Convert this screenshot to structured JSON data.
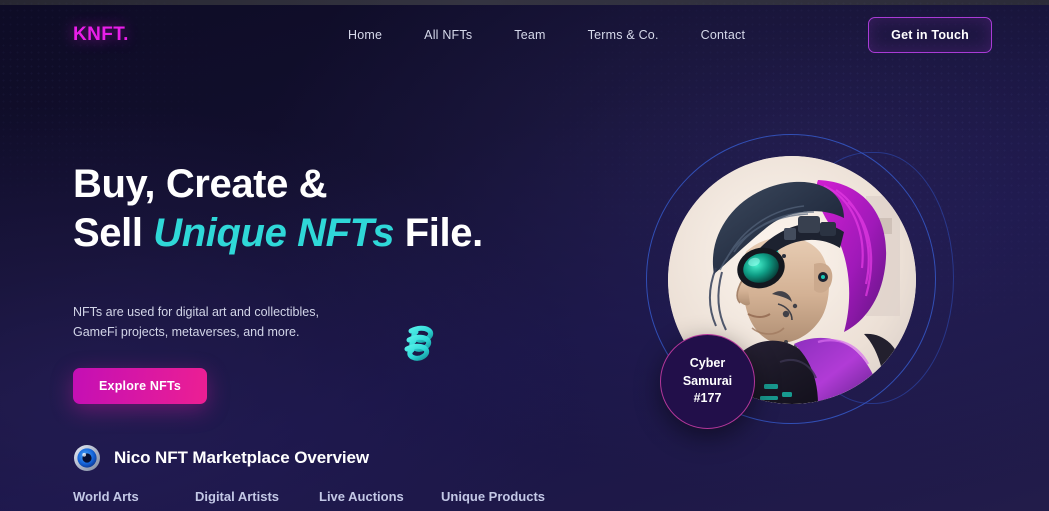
{
  "brand": {
    "logo": "KNFT."
  },
  "nav": {
    "items": [
      {
        "label": "Home"
      },
      {
        "label": "All NFTs"
      },
      {
        "label": "Team"
      },
      {
        "label": "Terms & Co."
      },
      {
        "label": "Contact"
      }
    ],
    "cta_label": "Get in Touch"
  },
  "hero": {
    "headline_line1": "Buy, Create &",
    "headline_line2_pre": "Sell ",
    "headline_line2_accent": "Unique NFTs",
    "headline_line2_post": " File.",
    "paragraph": "NFTs are used for digital art and collectibles, GameFi projects, metaverses, and more.",
    "explore_label": "Explore NFTs",
    "badge_line1": "Cyber",
    "badge_line2": "Samurai",
    "badge_line3": "#177"
  },
  "overview": {
    "title": "Nico NFT Marketplace Overview",
    "features": [
      {
        "label": "World Arts"
      },
      {
        "label": "Digital Artists"
      },
      {
        "label": "Live Auctions"
      },
      {
        "label": "Unique Products"
      }
    ]
  },
  "colors": {
    "background": "#120f2e",
    "background_bottom": "#221c4a",
    "brand_magenta": "#e91ee9",
    "accent_cyan": "#2fd8d8",
    "button_gradient_start": "#c40fb5",
    "button_gradient_end": "#ec1f93",
    "outline_border": "#a93bd6",
    "ring_blue": "#3558c8",
    "badge_background": "#220f4a",
    "badge_border": "#b3369a",
    "nav_text": "#d6d9ea"
  }
}
